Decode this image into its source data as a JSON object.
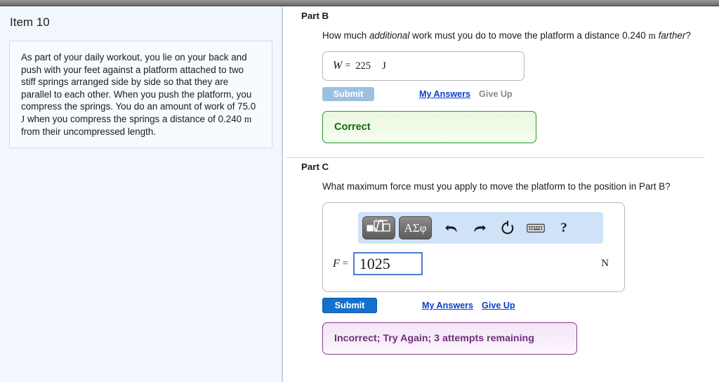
{
  "left_panel": {
    "item_title": "Item 10",
    "item_text_lines": [
      "As part of your daily workout, you lie on your back and push with your feet against a platform attached to two stiff springs arranged side by side so that they are parallel to each other. When you push the platform, you compress the springs. You do an amount of work of 75.0 J when you compress the springs a distance of 0.240 m from their uncompressed length."
    ],
    "item_text_prefix": "As part of your daily workout, you lie on your back and push with your feet against a platform attached to two stiff springs arranged side by side so that they are parallel to each other. When you push the platform, you compress the springs. You do an amount of work of 75.0 ",
    "item_text_unit_j": "J",
    "item_text_mid": " when you compress the springs a distance of 0.240 ",
    "item_text_unit_m": "m",
    "item_text_suffix": " from their uncompressed length."
  },
  "part_b": {
    "heading": "Part B",
    "question_prefix": "How much ",
    "question_em1": "additional",
    "question_mid": " work must you do to move the platform a distance 0.240 ",
    "question_unit": "m",
    "question_em2": " farther",
    "question_suffix": "?",
    "answer": {
      "variable": "W",
      "equals": "=",
      "value": "225",
      "unit": "J"
    },
    "submit_label": "Submit",
    "submit_state": "disabled",
    "my_answers_label": "My Answers",
    "give_up_label": "Give Up",
    "give_up_state": "disabled",
    "feedback": {
      "type": "correct",
      "text": "Correct"
    }
  },
  "part_c": {
    "heading": "Part C",
    "question": "What maximum force must you apply to move the platform to the position in Part B?",
    "toolbar": {
      "template_button": "template-icon",
      "greek_button": "ΑΣφ",
      "undo_icon": "undo-icon",
      "redo_icon": "redo-icon",
      "reset_icon": "reset-icon",
      "keyboard_icon": "keyboard-icon",
      "help_icon": "?"
    },
    "answer": {
      "variable": "F",
      "equals": "=",
      "value": "1025",
      "unit": "N"
    },
    "submit_label": "Submit",
    "submit_state": "active",
    "my_answers_label": "My Answers",
    "give_up_label": "Give Up",
    "give_up_state": "active",
    "feedback": {
      "type": "incorrect",
      "text": "Incorrect; Try Again; 3 attempts remaining"
    }
  },
  "colors": {
    "panel_bg": "#f2f6fd",
    "submit_active": "#1570cd",
    "submit_disabled": "#9dc0e0",
    "link": "#0b3ec4",
    "correct_border": "#1f9c1f",
    "correct_text": "#14660f",
    "incorrect_border": "#883a8e",
    "incorrect_text": "#6f2f7b",
    "toolbar_bg": "#cfe2f7",
    "input_focus_border": "#4a7fd0"
  }
}
